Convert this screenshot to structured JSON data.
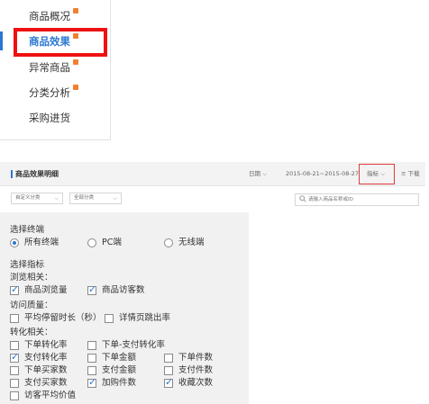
{
  "sidebar": {
    "items": [
      {
        "label": "商品概况"
      },
      {
        "label": "商品效果"
      },
      {
        "label": "异常商品"
      },
      {
        "label": "分类分析"
      },
      {
        "label": "采购进货"
      }
    ],
    "accent_color": "#2a77d2",
    "hot_badge_color": "#f08030",
    "highlight_color": "#ee1111"
  },
  "report": {
    "title": "商品效果明细",
    "date_label": "日期",
    "date_range": "2015-08-21~2015-08-27",
    "metric_label": "指标",
    "download_label": "下载"
  },
  "filters": {
    "select_1": "自定义分类",
    "select_2": "全部分类",
    "search_placeholder": "请输入商品名称或ID"
  },
  "panel": {
    "terminal_heading": "选择终端",
    "terminals": [
      {
        "label": "所有终端",
        "selected": true
      },
      {
        "label": "PC端",
        "selected": false
      },
      {
        "label": "无线端",
        "selected": false
      }
    ],
    "metric_heading": "选择指标",
    "groups": [
      {
        "heading": "浏览相关：",
        "items": [
          {
            "label": "商品浏览量",
            "checked": true
          },
          {
            "label": "商品访客数",
            "checked": true
          }
        ]
      },
      {
        "heading": "访问质量：",
        "items": [
          {
            "label": "平均停留时长（秒）",
            "checked": false
          },
          {
            "label": "详情页跳出率",
            "checked": false
          }
        ]
      },
      {
        "heading": "转化相关：",
        "items": [
          {
            "label": "下单转化率",
            "checked": false
          },
          {
            "label": "下单-支付转化率",
            "checked": false
          },
          {
            "label": "支付转化率",
            "checked": true
          },
          {
            "label": "下单金额",
            "checked": false
          },
          {
            "label": "下单件数",
            "checked": false
          },
          {
            "label": "下单买家数",
            "checked": false
          },
          {
            "label": "支付金额",
            "checked": false
          },
          {
            "label": "支付件数",
            "checked": false
          },
          {
            "label": "支付买家数",
            "checked": false
          },
          {
            "label": "加购件数",
            "checked": true
          },
          {
            "label": "收藏次数",
            "checked": true
          },
          {
            "label": "访客平均价值",
            "checked": false
          }
        ]
      }
    ]
  }
}
